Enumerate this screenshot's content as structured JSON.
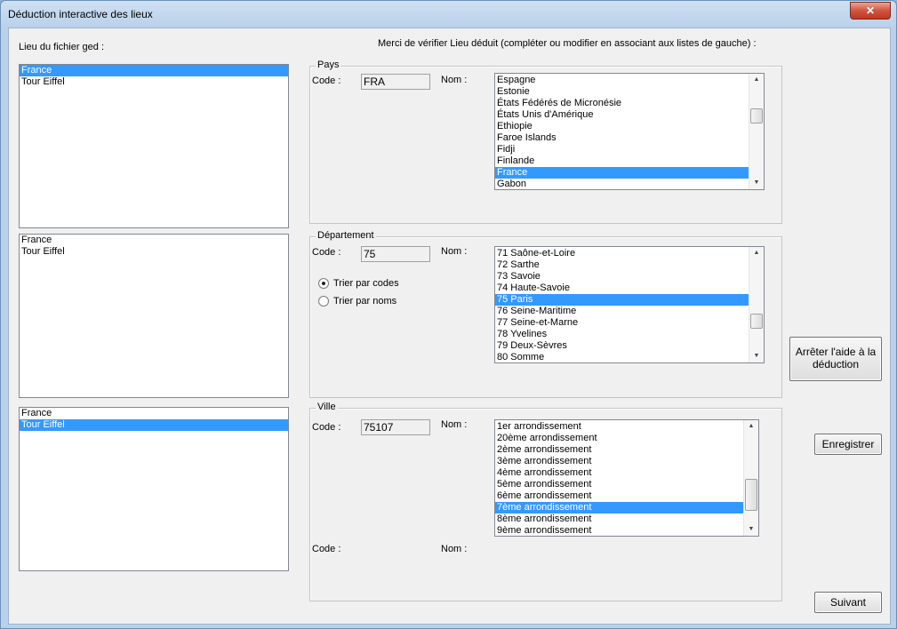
{
  "window": {
    "title": "Déduction interactive des lieux",
    "close_glyph": "✕"
  },
  "left": {
    "label": "Lieu du fichier ged :",
    "lists": [
      {
        "items": [
          "France",
          "Tour Eiffel"
        ],
        "selected": 0
      },
      {
        "items": [
          "France",
          "Tour Eiffel"
        ],
        "selected": -1
      },
      {
        "items": [
          "France",
          "Tour Eiffel"
        ],
        "selected": 1
      }
    ]
  },
  "header": {
    "instruction": "Merci de vérifier Lieu déduit (compléter ou modifier en associant aux listes de gauche) :"
  },
  "pays": {
    "legend": "Pays",
    "code_label": "Code :",
    "code_value": "FRA",
    "nom_label": "Nom :",
    "items": [
      "Espagne",
      "Estonie",
      "États Fédérés de Micronésie",
      "États Unis d'Amérique",
      "Ethiopie",
      "Faroe Islands",
      "Fidji",
      "Finlande",
      "France",
      "Gabon"
    ],
    "selected": 8
  },
  "departement": {
    "legend": "Département",
    "code_label": "Code :",
    "code_value": "75",
    "nom_label": "Nom :",
    "sort_by_codes": "Trier par codes",
    "sort_by_names": "Trier par noms",
    "sort_mode": "codes",
    "items": [
      "71 Saône-et-Loire",
      "72 Sarthe",
      "73 Savoie",
      "74 Haute-Savoie",
      "75 Paris",
      "76 Seine-Maritime",
      "77 Seine-et-Marne",
      "78 Yvelines",
      "79 Deux-Sèvres",
      "80 Somme"
    ],
    "selected": 4
  },
  "ville": {
    "legend": "Ville",
    "code_label": "Code :",
    "code_value": "75107",
    "nom_label": "Nom :",
    "items": [
      "1er arrondissement",
      "20ème arrondissement",
      "2ème arrondissement",
      "3ème arrondissement",
      "4ème arrondissement",
      "5ème arrondissement",
      "6ème arrondissement",
      "7ème arrondissement",
      "8ème arrondissement",
      "9ème arrondissement"
    ],
    "selected": 7,
    "extra_code_label": "Code :",
    "extra_nom_label": "Nom :"
  },
  "buttons": {
    "stop_help": "Arrêter l'aide à la déduction",
    "save": "Enregistrer",
    "next": "Suivant"
  }
}
